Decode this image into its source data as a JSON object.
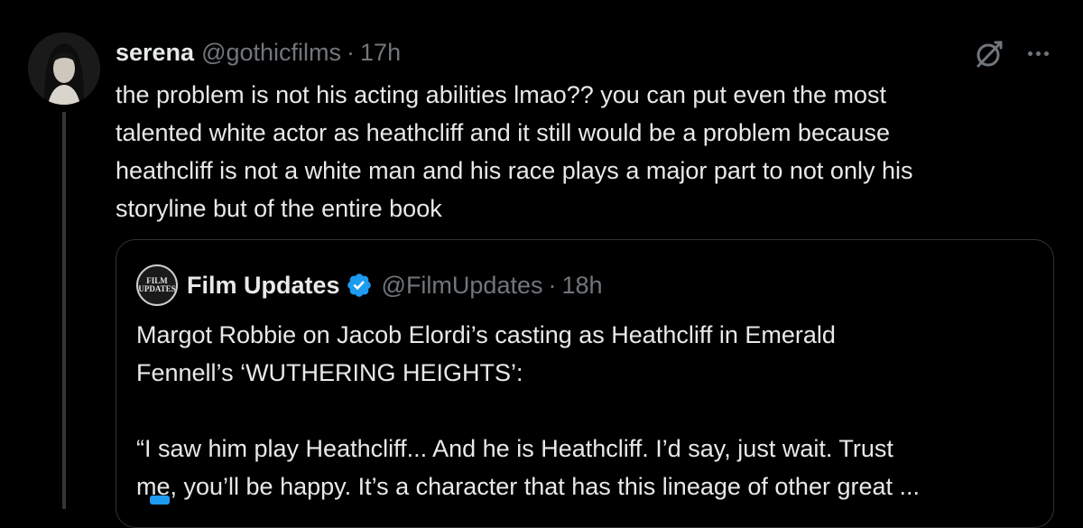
{
  "tweet": {
    "author_name": "serena",
    "handle": "@gothicfilms",
    "separator": "·",
    "time": "17h",
    "text_lines": [
      "the problem is not his acting abilities lmao?? you can put even the most",
      "talented white actor as heathcliff and it still would be a problem because",
      "heathcliff is not a white man and his race plays a major part to not only his",
      "storyline but of the entire book"
    ],
    "icons": {
      "grok": "grok-icon",
      "more": "more-dots-icon"
    }
  },
  "quote": {
    "avatar_text": [
      "FILM",
      "UPDATES"
    ],
    "author_name": "Film Updates",
    "verified": true,
    "handle": "@FilmUpdates",
    "separator": "·",
    "time": "18h",
    "text_lines": [
      "Margot Robbie on Jacob Elordi’s casting as Heathcliff in Emerald",
      "Fennell’s ‘WUTHERING HEIGHTS’:",
      "",
      "“I saw him play Heathcliff... And he is Heathcliff. I’d say, just wait. Trust",
      "me, you’ll be happy. It’s a character that has this lineage of other great ..."
    ]
  },
  "colors": {
    "background": "#000000",
    "text": "#e7e9ea",
    "muted": "#71767b",
    "border": "#2f3336",
    "thread_line": "#333639",
    "verified": "#1d9bf0"
  }
}
